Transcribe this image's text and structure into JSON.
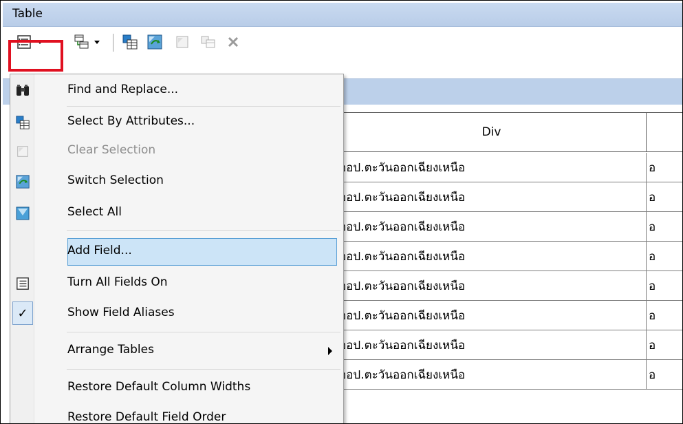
{
  "window": {
    "title": "Table"
  },
  "toolbar": {
    "icons": [
      "table-options-icon",
      "dropdown-arrow-icon",
      "related-tables-icon",
      "dropdown-arrow-icon",
      "select-by-attributes-icon",
      "switch-selection-icon",
      "clear-selection-icon",
      "zoom-to-selected-icon",
      "delete-selected-icon"
    ]
  },
  "table": {
    "columns": [
      "Div"
    ],
    "rows": [
      "ออป.ตะวันออกเฉียงเหนือ",
      "ออป.ตะวันออกเฉียงเหนือ",
      "ออป.ตะวันออกเฉียงเหนือ",
      "ออป.ตะวันออกเฉียงเหนือ",
      "ออป.ตะวันออกเฉียงเหนือ",
      "ออป.ตะวันออกเฉียงเหนือ",
      "ออป.ตะวันออกเฉียงเหนือ",
      "ออป.ตะวันออกเฉียงเหนือ"
    ],
    "next_column_prefix": "อ"
  },
  "menu": {
    "items": [
      {
        "label": "Find and Replace...",
        "icon": "binoculars-icon",
        "disabled": false
      },
      {
        "label": "Select By Attributes...",
        "icon": "select-by-attributes-icon",
        "disabled": false
      },
      {
        "label": "Clear Selection",
        "icon": "clear-selection-icon",
        "disabled": true
      },
      {
        "label": "Switch Selection",
        "icon": "switch-selection-icon",
        "disabled": false
      },
      {
        "label": "Select All",
        "icon": "select-all-icon",
        "disabled": false
      },
      {
        "label": "Add Field...",
        "icon": "",
        "disabled": false,
        "highlighted": true
      },
      {
        "label": "Turn All Fields On",
        "icon": "fields-list-icon",
        "disabled": false
      },
      {
        "label": "Show Field Aliases",
        "icon": "checkmark-icon",
        "disabled": false,
        "checked": true
      },
      {
        "label": "Arrange Tables",
        "icon": "",
        "disabled": false,
        "submenu": true
      },
      {
        "label": "Restore Default Column Widths",
        "icon": "",
        "disabled": false
      },
      {
        "label": "Restore Default Field Order",
        "icon": "",
        "disabled": false
      }
    ]
  },
  "colors": {
    "highlight": "#cce4f7",
    "highlight_border": "#5aa0d6",
    "callout": "#e01020",
    "titlebar": "#c1d4ec"
  }
}
